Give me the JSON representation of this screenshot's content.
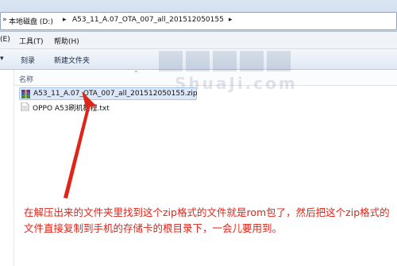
{
  "address_bar": {
    "back_arrow": "»",
    "segments": [
      "本地磁盘 (D:)",
      "A53_11_A.07_OTA_007_all_201512050155"
    ],
    "separator_icon": "chevron-right-icon"
  },
  "menu": {
    "items": [
      "(E)",
      "工具(T)",
      "帮助(H)"
    ]
  },
  "commands": {
    "items": [
      "刻录",
      "新建文件夹"
    ]
  },
  "file_list": {
    "column_header": "名称",
    "files": [
      {
        "name": "A53_11_A.07_OTA_007_all_201512050155.zip",
        "icon": "zip-archive-icon",
        "selected": true
      },
      {
        "name": "OPPO A53刷机教程.txt",
        "icon": "text-file-icon",
        "selected": false
      }
    ]
  },
  "watermark": {
    "line1": "刷机",
    "line2": "ShuaJi.com"
  },
  "annotation": {
    "text": "在解压出来的文件夹里找到这个zip格式的文件就是rom包了，然后把这个zip格式的文件直接复制到手机的存储卡的根目录下，一会儿要用到。",
    "color": "#e02418"
  }
}
